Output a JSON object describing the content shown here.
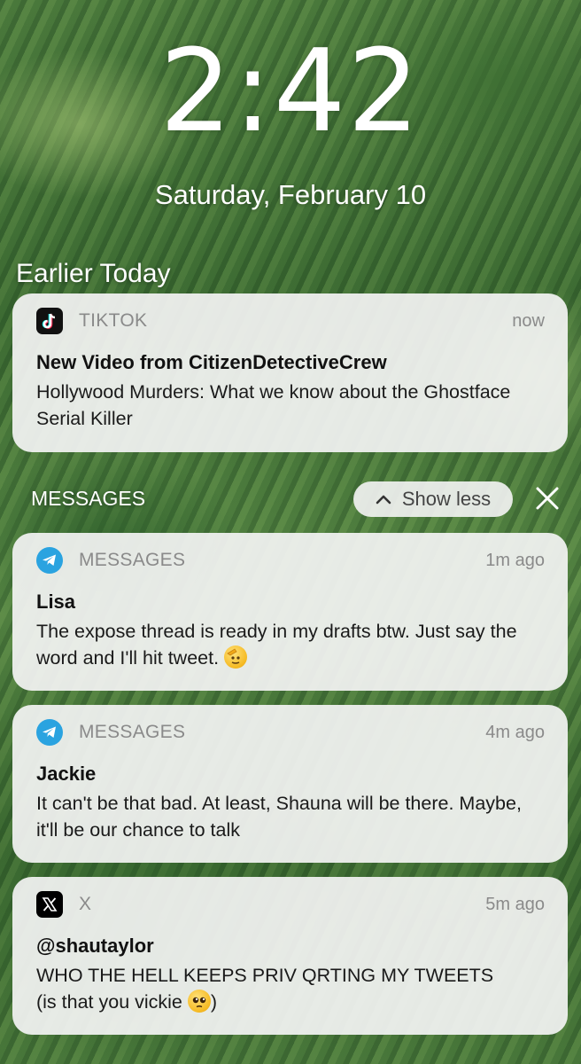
{
  "lockscreen": {
    "time": "2:42",
    "date": "Saturday, February 10",
    "section_title": "Earlier Today"
  },
  "notifications": [
    {
      "app": "TIKTOK",
      "icon": "tiktok-icon",
      "time": "now",
      "title": "New Video from CitizenDetectiveCrew",
      "body": "Hollywood Murders: What we know about the Ghostface Serial Killer"
    }
  ],
  "group": {
    "title": "MESSAGES",
    "show_less_label": "Show less",
    "items": [
      {
        "app": "MESSAGES",
        "icon": "telegram-icon",
        "time": "1m ago",
        "title": "Lisa",
        "body": "The expose thread is ready in my drafts btw. Just say the word and I'll hit tweet.",
        "emoji": "saluting-face"
      },
      {
        "app": "MESSAGES",
        "icon": "telegram-icon",
        "time": "4m ago",
        "title": "Jackie",
        "body": "It can't be that bad. At least, Shauna will be there. Maybe, it'll be our chance to talk"
      }
    ]
  },
  "x_notification": {
    "app": "X",
    "icon": "x-logo-icon",
    "time": "5m ago",
    "title": "@shautaylor",
    "body_line1": "WHO THE HELL KEEPS PRIV QRTING MY TWEETS",
    "body_line2": "(is that you vickie",
    "body_suffix": ")",
    "emoji": "pleading-face"
  }
}
